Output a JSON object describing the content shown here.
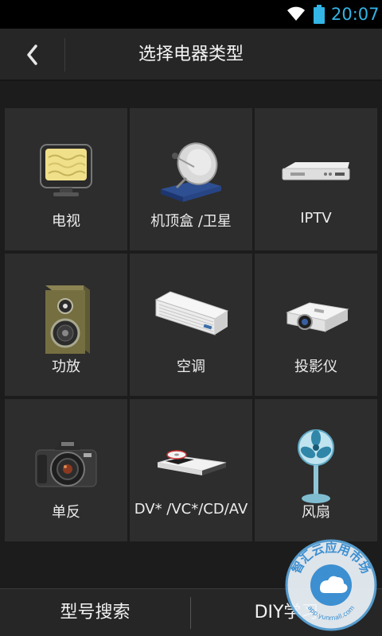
{
  "status_bar": {
    "time": "20:07",
    "icons": [
      "wifi-icon",
      "battery-icon"
    ],
    "accent": "#33b5e5"
  },
  "header": {
    "back_icon": "chevron-left-icon",
    "title": "选择电器类型"
  },
  "devices": [
    {
      "id": "tv",
      "label": "电视",
      "icon": "tv-icon"
    },
    {
      "id": "stb",
      "label": "机顶盒 /卫星",
      "icon": "satellite-dish-icon"
    },
    {
      "id": "iptv",
      "label": "IPTV",
      "icon": "set-top-box-icon"
    },
    {
      "id": "amp",
      "label": "功放",
      "icon": "speaker-icon"
    },
    {
      "id": "ac",
      "label": "空调",
      "icon": "air-conditioner-icon"
    },
    {
      "id": "projector",
      "label": "投影仪",
      "icon": "projector-icon"
    },
    {
      "id": "dslr",
      "label": "单反",
      "icon": "camera-icon"
    },
    {
      "id": "dvd",
      "label": "DV* /VC*/CD/AV",
      "icon": "dvd-player-icon"
    },
    {
      "id": "fan",
      "label": "风扇",
      "icon": "fan-icon"
    }
  ],
  "bottom": {
    "model_search": "型号搜索",
    "diy_learn": "DIY学习"
  },
  "watermark": {
    "text": "智汇云应用市场",
    "url": "app.yunmall.com"
  },
  "colors": {
    "background": "#1c1c1c",
    "tile": "#2d2d2d",
    "bar": "#262626"
  }
}
